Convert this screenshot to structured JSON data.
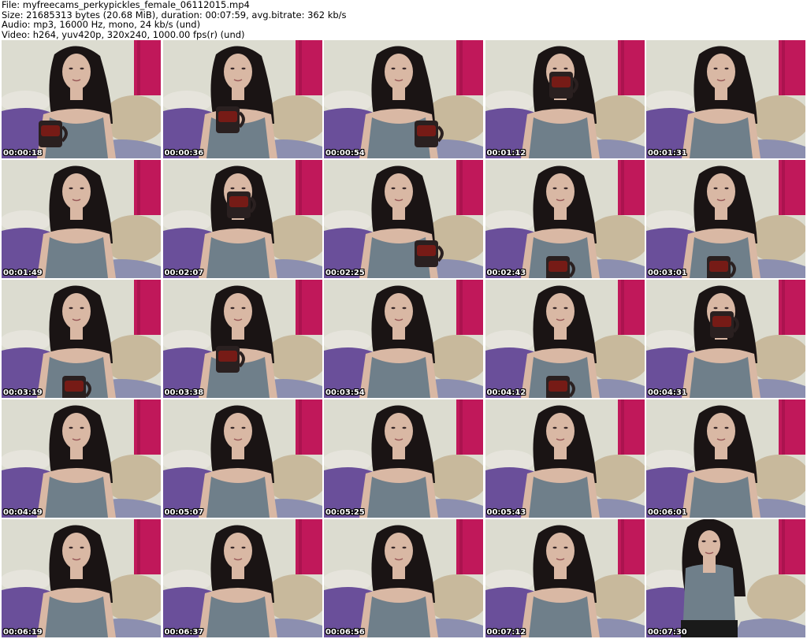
{
  "header": {
    "file": "File: myfreecams_perkypickles_female_06112015.mp4",
    "size": "Size: 21685313 bytes (20.68 MiB), duration: 00:07:59, avg.bitrate: 362 kb/s",
    "audio": "Audio: mp3, 16000 Hz, mono, 24 kb/s (und)",
    "video": "Video: h264, yuv420p, 320x240, 1000.00 fps(r) (und)"
  },
  "colors": {
    "wall": "#dcdcd0",
    "curtain": "#c0185a",
    "blanket": "#6a4f9a",
    "pillow": "#c8b99c",
    "hair": "#1a1414",
    "skin": "#d9b8a4",
    "top": "#6f7f8a",
    "mug": "#2a2020",
    "mug_accent": "#8a1a14"
  },
  "thumbnails": [
    {
      "timestamp": "00:00:18",
      "mug": "left"
    },
    {
      "timestamp": "00:00:36",
      "mug": "raised"
    },
    {
      "timestamp": "00:00:54",
      "mug": "right"
    },
    {
      "timestamp": "00:01:12",
      "mug": "drinking"
    },
    {
      "timestamp": "00:01:31",
      "mug": "none"
    },
    {
      "timestamp": "00:01:49",
      "mug": "none"
    },
    {
      "timestamp": "00:02:07",
      "mug": "drinking"
    },
    {
      "timestamp": "00:02:25",
      "mug": "right"
    },
    {
      "timestamp": "00:02:43",
      "mug": "center"
    },
    {
      "timestamp": "00:03:01",
      "mug": "center"
    },
    {
      "timestamp": "00:03:19",
      "mug": "center"
    },
    {
      "timestamp": "00:03:38",
      "mug": "raised"
    },
    {
      "timestamp": "00:03:54",
      "mug": "none"
    },
    {
      "timestamp": "00:04:12",
      "mug": "center"
    },
    {
      "timestamp": "00:04:31",
      "mug": "drinking"
    },
    {
      "timestamp": "00:04:49",
      "mug": "none"
    },
    {
      "timestamp": "00:05:07",
      "mug": "none"
    },
    {
      "timestamp": "00:05:25",
      "mug": "none"
    },
    {
      "timestamp": "00:05:43",
      "mug": "none"
    },
    {
      "timestamp": "00:06:01",
      "mug": "none"
    },
    {
      "timestamp": "00:06:19",
      "mug": "none"
    },
    {
      "timestamp": "00:06:37",
      "mug": "none"
    },
    {
      "timestamp": "00:06:56",
      "mug": "none"
    },
    {
      "timestamp": "00:07:12",
      "mug": "none"
    },
    {
      "timestamp": "00:07:30",
      "mug": "wide"
    }
  ]
}
